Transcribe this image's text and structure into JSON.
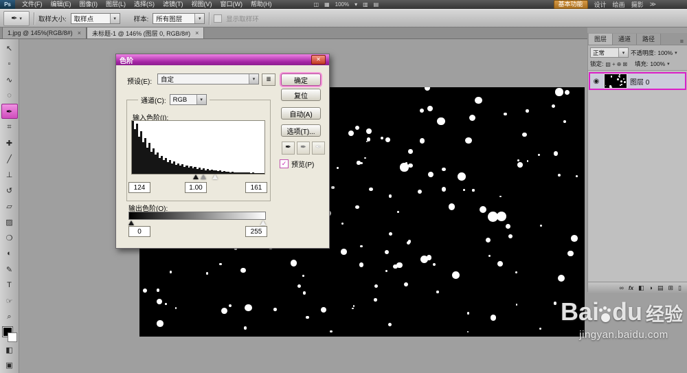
{
  "glyphs": {
    "dropdown_arrow": "▾",
    "close": "×",
    "dialog_close": "✕",
    "check": "✓",
    "eye": "◉",
    "eyedropper": "✒",
    "panel_menu": "≡",
    "preset_menu": "≣"
  },
  "menubar": {
    "logo": "Ps",
    "items": [
      {
        "name": "menu-file",
        "label": "文件(F)"
      },
      {
        "name": "menu-edit",
        "label": "编辑(E)"
      },
      {
        "name": "menu-image",
        "label": "图像(I)"
      },
      {
        "name": "menu-layer",
        "label": "图层(L)"
      },
      {
        "name": "menu-select",
        "label": "选择(S)"
      },
      {
        "name": "menu-filter",
        "label": "滤镜(T)"
      },
      {
        "name": "menu-view",
        "label": "视图(V)"
      },
      {
        "name": "menu-window",
        "label": "窗口(W)"
      },
      {
        "name": "menu-help",
        "label": "帮助(H)"
      }
    ],
    "app_icons": [
      {
        "name": "launch-bridge-icon",
        "glyph": "◫"
      },
      {
        "name": "view-extras-icon",
        "glyph": "▦"
      },
      {
        "name": "zoom-level",
        "glyph": "100%"
      },
      {
        "name": "zoom-dropdown-icon",
        "glyph": "▾"
      },
      {
        "name": "arrange-documents-icon",
        "glyph": "▥"
      },
      {
        "name": "screen-mode-icon",
        "glyph": "▤"
      }
    ],
    "workspace": {
      "active": "基本功能",
      "others": [
        "设计",
        "绘画",
        "摄影"
      ],
      "overflow_chevron": "≫"
    }
  },
  "optionsbar": {
    "tool_glyph": "✒",
    "sample_size_label": "取样大小:",
    "sample_size_value": "取样点",
    "sample_label": "样本:",
    "sample_value": "所有图层",
    "ring_label": "显示取样环"
  },
  "tabs": [
    {
      "label": "1.jpg @ 145%(RGB/8#)",
      "active": false
    },
    {
      "label": "未标题-1 @ 146% (图层 0, RGB/8#)",
      "active": true
    }
  ],
  "toolbar": {
    "tools": [
      {
        "name": "move-tool",
        "glyph": "↖",
        "selected": false
      },
      {
        "name": "rectangular-marquee-tool",
        "glyph": "▫",
        "selected": false
      },
      {
        "name": "lasso-tool",
        "glyph": "∿",
        "selected": false
      },
      {
        "name": "quick-selection-tool",
        "glyph": "◌",
        "selected": false
      },
      {
        "name": "eyedropper-tool",
        "glyph": "✒",
        "selected": true
      },
      {
        "name": "crop-tool",
        "glyph": "⌗",
        "selected": false
      },
      {
        "name": "spot-healing-brush-tool",
        "glyph": "✚",
        "selected": false
      },
      {
        "name": "brush-tool",
        "glyph": "╱",
        "selected": false
      },
      {
        "name": "clone-stamp-tool",
        "glyph": "⊥",
        "selected": false
      },
      {
        "name": "history-brush-tool",
        "glyph": "↺",
        "selected": false
      },
      {
        "name": "eraser-tool",
        "glyph": "▱",
        "selected": false
      },
      {
        "name": "gradient-tool",
        "glyph": "▨",
        "selected": false
      },
      {
        "name": "blur-tool",
        "glyph": "❍",
        "selected": false
      },
      {
        "name": "dodge-tool",
        "glyph": "◐",
        "selected": false
      },
      {
        "name": "pen-tool",
        "glyph": "✎",
        "selected": false
      },
      {
        "name": "type-tool",
        "glyph": "T",
        "selected": false
      },
      {
        "name": "hand-tool",
        "glyph": "☞",
        "selected": false
      },
      {
        "name": "zoom-tool",
        "glyph": "⌕",
        "selected": false
      }
    ]
  },
  "dialog": {
    "title": "色阶",
    "preset_label": "预设(E):",
    "preset_value": "自定",
    "channel_label": "通道(C):",
    "channel_value": "RGB",
    "input_label": "输入色阶(I):",
    "input_values": [
      "124",
      "1.00",
      "161"
    ],
    "output_label": "输出色阶(O):",
    "output_values": [
      "0",
      "255"
    ],
    "buttons": {
      "ok": "确定",
      "reset": "复位",
      "auto": "自动(A)",
      "options": "选项(T)..."
    },
    "preview_label": "预览(P)",
    "histogram": [
      100,
      85,
      95,
      70,
      80,
      60,
      68,
      50,
      58,
      42,
      48,
      36,
      40,
      30,
      34,
      26,
      30,
      22,
      26,
      19,
      23,
      17,
      20,
      15,
      18,
      13,
      16,
      12,
      14,
      10,
      13,
      9,
      12,
      8,
      10,
      7,
      9,
      6,
      8,
      6,
      7,
      5,
      6,
      4,
      5,
      4,
      4,
      3,
      4,
      3,
      3,
      2,
      3,
      2,
      2,
      2,
      2,
      1,
      2,
      1,
      1,
      1,
      1,
      1
    ],
    "input_sliders": [
      {
        "name": "input-shadow-slider",
        "pos": 0.486,
        "color": "#1b1b1b"
      },
      {
        "name": "input-midtone-slider",
        "pos": 0.545,
        "color": "#9a9a9a"
      },
      {
        "name": "input-highlight-slider",
        "pos": 0.631,
        "color": "#f2f2f2"
      }
    ],
    "output_sliders": [
      {
        "name": "output-shadow-slider",
        "pos": 0.0,
        "color": "#1b1b1b"
      },
      {
        "name": "output-highlight-slider",
        "pos": 1.0,
        "color": "#f2f2f2"
      }
    ],
    "droppers": [
      {
        "name": "set-black-point-eyedropper",
        "color": "#111111"
      },
      {
        "name": "set-gray-point-eyedropper",
        "color": "#808080"
      },
      {
        "name": "set-white-point-eyedropper",
        "color": "#f5f5f5"
      }
    ]
  },
  "right_panel": {
    "tabs": [
      {
        "label": "图层",
        "active": true
      },
      {
        "label": "通道",
        "active": false
      },
      {
        "label": "路径",
        "active": false
      }
    ],
    "blend_mode": "正常",
    "opacity_label": "不透明度:",
    "opacity_value": "100%",
    "lock_label": "锁定:",
    "lock_icons": [
      {
        "name": "lock-transparent-pixels-icon",
        "glyph": "▧"
      },
      {
        "name": "lock-image-pixels-icon",
        "glyph": "+"
      },
      {
        "name": "lock-position-icon",
        "glyph": "⊕"
      },
      {
        "name": "lock-all-icon",
        "glyph": "⊠"
      }
    ],
    "fill_label": "填充:",
    "fill_value": "100%",
    "layer": {
      "name": "图层 0"
    },
    "bottom_icons": [
      {
        "name": "link-layers-icon",
        "glyph": "∞"
      },
      {
        "name": "layer-style-icon",
        "glyph": "fx"
      },
      {
        "name": "add-layer-mask-icon",
        "glyph": "◧"
      },
      {
        "name": "new-adjustment-layer-icon",
        "glyph": "◑"
      },
      {
        "name": "new-group-icon",
        "glyph": "▤"
      },
      {
        "name": "new-layer-icon",
        "glyph": "⊞"
      },
      {
        "name": "delete-layer-icon",
        "glyph": "▯"
      }
    ]
  },
  "canvas": {
    "background": "#000000",
    "dots": {
      "count": 175,
      "seed": 12
    },
    "thumb_dots": {
      "count": 16,
      "seed": 5
    }
  },
  "watermark": {
    "brand_prefix": "Bai",
    "brand_suffix": "du",
    "brand_cn": "经验",
    "url": "jingyan.baidu.com"
  }
}
